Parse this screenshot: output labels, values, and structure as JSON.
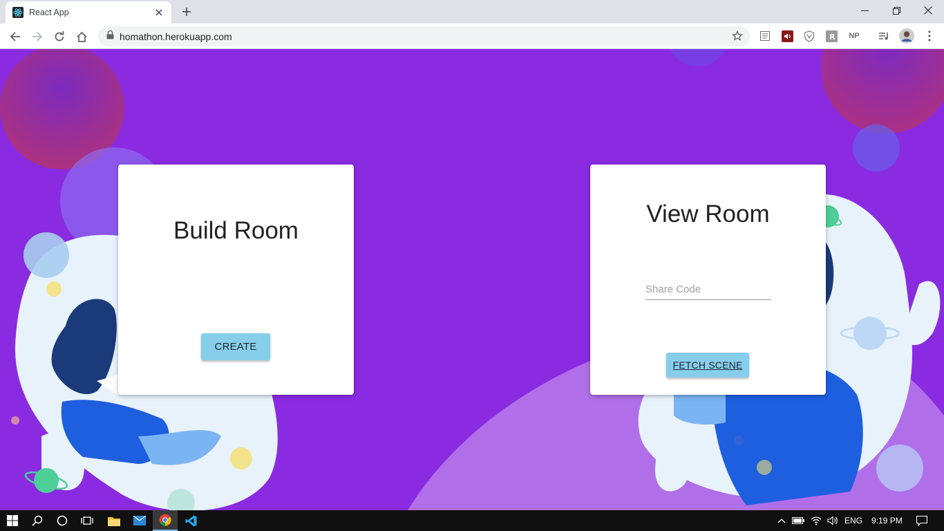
{
  "browser": {
    "tab": {
      "title": "React App",
      "favicon": "react-logo-icon"
    },
    "url": "homathon.herokuapp.com",
    "extensions": [
      "reader-icon",
      "audio-icon",
      "shield-icon",
      "r-icon",
      "NP",
      "playlist-icon",
      "profile-avatar"
    ]
  },
  "page": {
    "background_color": "#8a2be2",
    "build_room": {
      "title": "Build Room",
      "button_label": "CREATE"
    },
    "view_room": {
      "title": "View Room",
      "share_placeholder": "Share Code",
      "share_value": "",
      "button_label": "FETCH SCENE"
    },
    "accent_color": "#87ceeb"
  },
  "taskbar": {
    "language": "ENG",
    "time": "9:19 PM"
  }
}
